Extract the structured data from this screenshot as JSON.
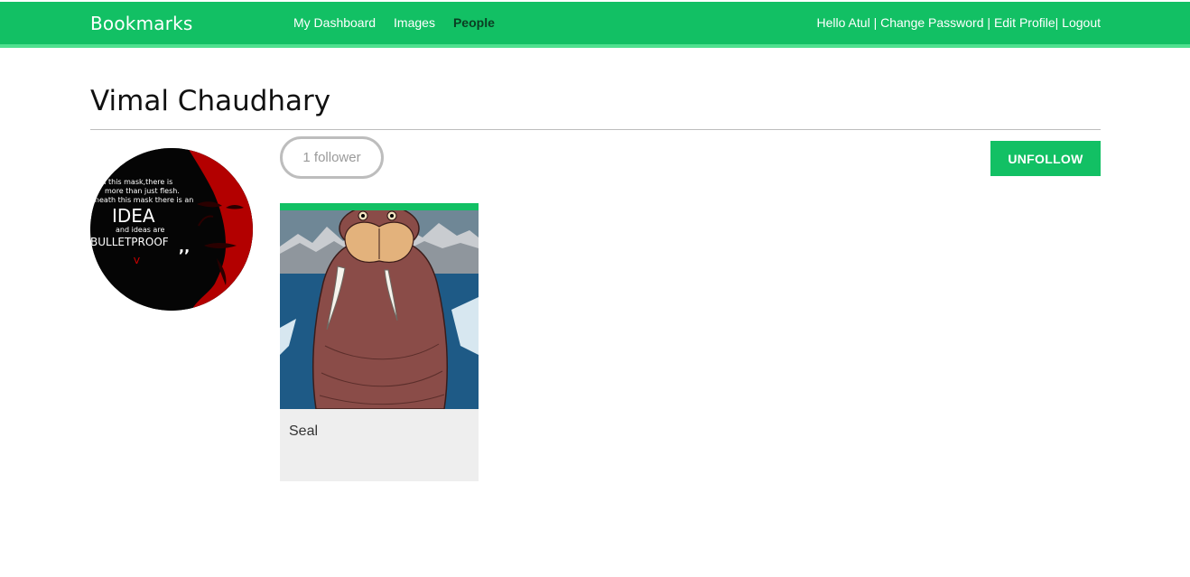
{
  "header": {
    "brand": "Bookmarks",
    "nav": [
      {
        "label": "My Dashboard",
        "active": false
      },
      {
        "label": "Images",
        "active": false
      },
      {
        "label": "People",
        "active": true
      }
    ],
    "user": {
      "greeting": "Hello Atul",
      "sep1": " | ",
      "change_password": "Change Password",
      "sep2": " | ",
      "edit_profile": "Edit Profile",
      "sep3": "| ",
      "logout": "Logout"
    }
  },
  "profile": {
    "name": "Vimal Chaudhary",
    "avatar_text": {
      "line1": "hind this mask,there is",
      "line2": "more than just flesh.",
      "line3": "eneath this mask there is an",
      "idea": "IDEA",
      "and": "and ideas are",
      "bullet": "BULLETPROOF",
      "quote": ",,",
      "v": "V"
    },
    "followers_label": "1 follower",
    "unfollow_label": "UNFOLLOW"
  },
  "images": [
    {
      "title": "Seal",
      "icon": "walrus-illustration"
    }
  ],
  "colors": {
    "accent": "#12c064",
    "accent_light": "#4fe08f",
    "card_bg": "#eeeeee"
  }
}
